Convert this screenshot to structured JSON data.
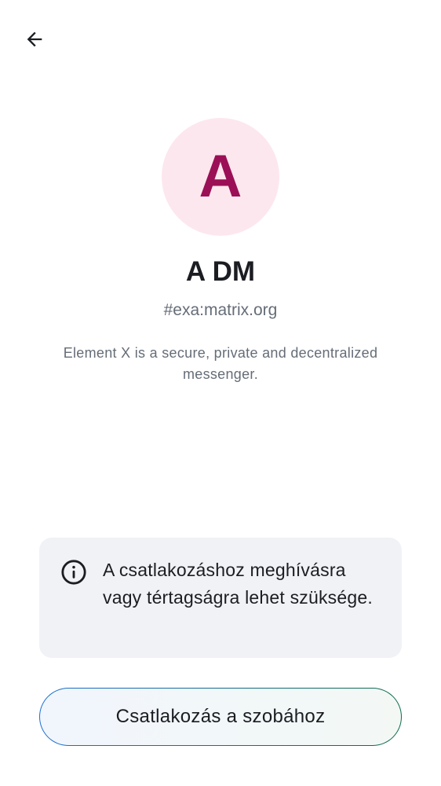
{
  "header": {
    "back_icon": "arrow-left-icon"
  },
  "room": {
    "avatar_letter": "A",
    "avatar_bg_color": "#fde7ee",
    "avatar_fg_color": "#9b0f56",
    "name": "A DM",
    "alias": "#exa:matrix.org",
    "topic": "Element X is a secure, private and decentralized messenger."
  },
  "notice": {
    "icon": "info-icon",
    "text": "A csatlakozáshoz meghívásra vagy tértagságra lehet szüksége."
  },
  "actions": {
    "join_label": "Csatlakozás a szobához"
  }
}
